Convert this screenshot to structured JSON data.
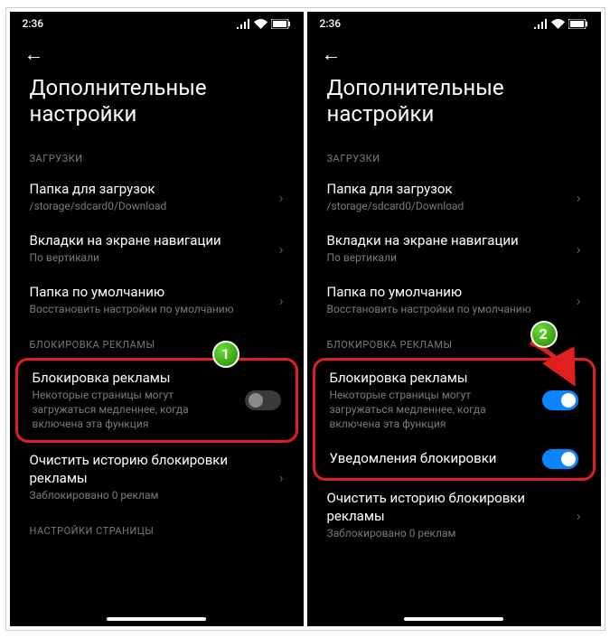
{
  "status": {
    "time": "2:36"
  },
  "page": {
    "title": "Дополнительные настройки",
    "sections": {
      "downloads": "ЗАГРУЗКИ",
      "adblock": "БЛОКИРОВКА РЕКЛАМЫ",
      "page_settings": "НАСТРОЙКИ СТРАНИЦЫ"
    },
    "download_folder": {
      "label": "Папка для загрузок",
      "sub": "/storage/sdcard0/Download"
    },
    "nav_tabs": {
      "label": "Вкладки на экране навигации",
      "sub": "По вертикали"
    },
    "default_folder": {
      "label": "Папка по умолчанию",
      "sub": "Восстановить настройки по умолчанию"
    },
    "adblock_toggle": {
      "label": "Блокировка рекламы",
      "sub": "Некоторые страницы могут загружаться медленнее, когда включена эта функция"
    },
    "adblock_notify": {
      "label": "Уведомления блокировки"
    },
    "clear_history": {
      "label": "Очистить историю блокировки рекламы",
      "sub": "Заблокировано 0 реклам"
    }
  },
  "steps": {
    "one": "1",
    "two": "2"
  }
}
